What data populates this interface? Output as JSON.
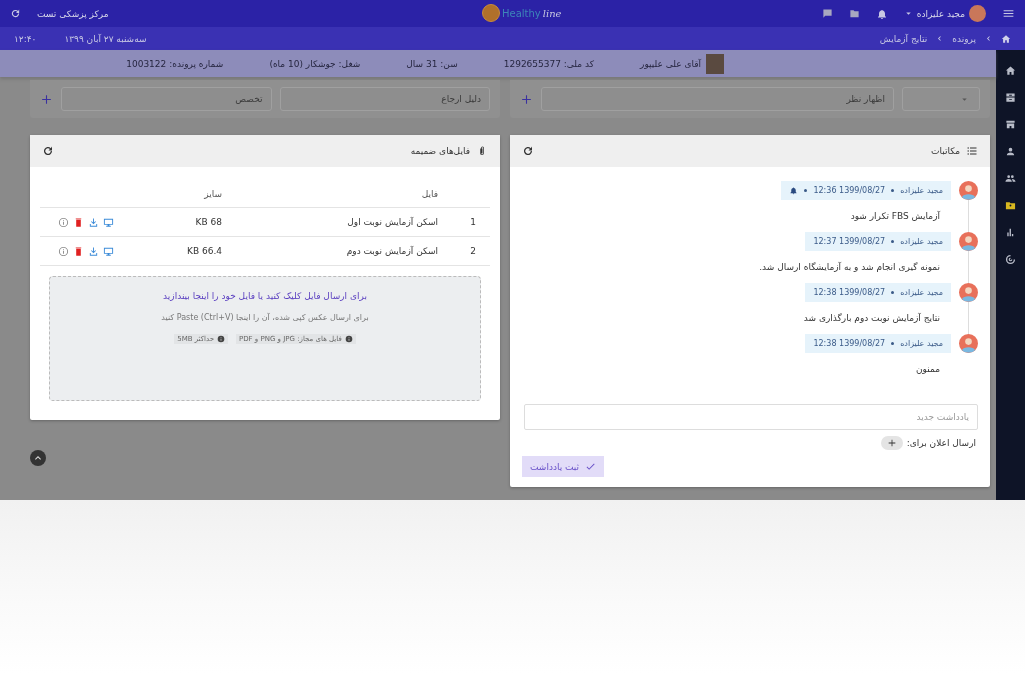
{
  "topbar": {
    "user_name": "مجید علیزاده",
    "logo": {
      "part1": "Healthy",
      "part2": "line"
    },
    "clinic": "مرکز پزشکی تست"
  },
  "subbar": {
    "breadcrumb": [
      "پرونده",
      "نتایج آزمایش"
    ],
    "date": "سه‌شنبه ۲۷ آبان ۱۳۹۹",
    "time": "۱۲:۴۰"
  },
  "sidebar": {
    "items": [
      {
        "selected": false
      },
      {
        "selected": false
      },
      {
        "selected": false
      },
      {
        "selected": false
      },
      {
        "selected": false
      },
      {
        "selected": true
      },
      {
        "selected": false
      },
      {
        "selected": false
      }
    ]
  },
  "patient": {
    "name": "آقای علی علیپور",
    "fields": [
      "کد ملی: 1292655377",
      "سن: 31 سال",
      "شغل: جوشکار (10 ماه)",
      "شماره پرونده: 1003122"
    ]
  },
  "filters": {
    "opinion": {
      "placeholder": "اظهار نظر"
    },
    "referral": {
      "placeholder": "دلیل ارجاع"
    },
    "specialty": {
      "placeholder": "تخصص"
    }
  },
  "correspondence": {
    "title": "مکاتبات",
    "messages": [
      {
        "author": "مجید علیزاده",
        "datetime": "1399/08/27 12:36",
        "notified": true,
        "text": "آزمایش FBS تکرار شود"
      },
      {
        "author": "مجید علیزاده",
        "datetime": "1399/08/27 12:37",
        "notified": false,
        "text": "نمونه گیری انجام شد و به آزمایشگاه ارسال شد."
      },
      {
        "author": "مجید علیزاده",
        "datetime": "1399/08/27 12:38",
        "notified": false,
        "text": "نتایج آزمایش نوبت دوم بارگذاری شد"
      },
      {
        "author": "مجید علیزاده",
        "datetime": "1399/08/27 12:38",
        "notified": false,
        "text": "ممنون"
      }
    ],
    "note": {
      "placeholder": "یادداشت جدید"
    },
    "notify_label": "ارسال اعلان برای:",
    "submit": "ثبت یادداشت"
  },
  "attachments": {
    "title": "فایل‌های ضمیمه",
    "columns": [
      "فایل",
      "سایز"
    ],
    "rows": [
      {
        "index": "1",
        "file": "اسکن آزمایش نوبت اول",
        "size": "68 KB"
      },
      {
        "index": "2",
        "file": "اسکن آزمایش نوبت دوم",
        "size": "66.4 KB"
      }
    ],
    "dropzone": {
      "title": "برای ارسال فایل کلیک کنید یا فایل خود را اینجا بیندازید",
      "hint": "برای ارسال عکس کپی شده، آن را اینجا (Ctrl+V) Paste کنید",
      "allowed": "فایل های مجاز: JPG و PNG و PDF",
      "max_size": "حداکثر 5MB"
    }
  }
}
